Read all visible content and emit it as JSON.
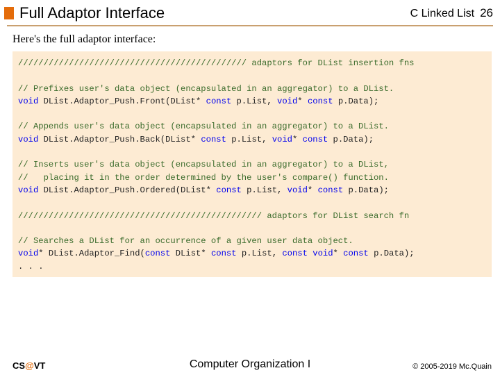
{
  "header": {
    "title": "Full Adaptor Interface",
    "course": "C Linked List",
    "slide_num": "26"
  },
  "intro": "Here's the full adaptor interface:",
  "code": {
    "l01_cmt": "///////////////////////////////////////////// adaptors for DList insertion fns",
    "l02": "",
    "l03_cmt": "// Prefixes user's data object (encapsulated in an aggregator) to a DList.",
    "l04_a": "void",
    "l04_b": " DList.Adaptor_Push.Front(DList* ",
    "l04_c": "const",
    "l04_d": " p.List, ",
    "l04_e": "void",
    "l04_f": "* ",
    "l04_g": "const",
    "l04_h": " p.Data);",
    "l05": "",
    "l06_cmt": "// Appends user's data object (encapsulated in an aggregator) to a DList.",
    "l07_a": "void",
    "l07_b": " DList.Adaptor_Push.Back(DList* ",
    "l07_c": "const",
    "l07_d": " p.List, ",
    "l07_e": "void",
    "l07_f": "* ",
    "l07_g": "const",
    "l07_h": " p.Data);",
    "l08": "",
    "l09_cmt": "// Inserts user's data object (encapsulated in an aggregator) to a DList,",
    "l10_cmt": "//   placing it in the order determined by the user's compare() function.",
    "l11_a": "void",
    "l11_b": " DList.Adaptor_Push.Ordered(DList* ",
    "l11_c": "const",
    "l11_d": " p.List, ",
    "l11_e": "void",
    "l11_f": "* ",
    "l11_g": "const",
    "l11_h": " p.Data);",
    "l12": "",
    "l13_cmt": "//////////////////////////////////////////////// adaptors for DList search fn",
    "l14": "",
    "l15_cmt": "// Searches a DList for an occurrence of a given user data object.",
    "l16_a": "void",
    "l16_b": "* DList.Adaptor_Find(",
    "l16_c": "const",
    "l16_d": " DList* ",
    "l16_e": "const",
    "l16_f": " p.List, ",
    "l16_g": "const",
    "l16_h": " ",
    "l16_i": "void",
    "l16_j": "* ",
    "l16_k": "const",
    "l16_l": " p.Data);",
    "l17": ". . ."
  },
  "footer": {
    "left_pre": "CS",
    "left_at": "@",
    "left_post": "VT",
    "center": "Computer Organization I",
    "right": "© 2005-2019 Mc.Quain"
  }
}
